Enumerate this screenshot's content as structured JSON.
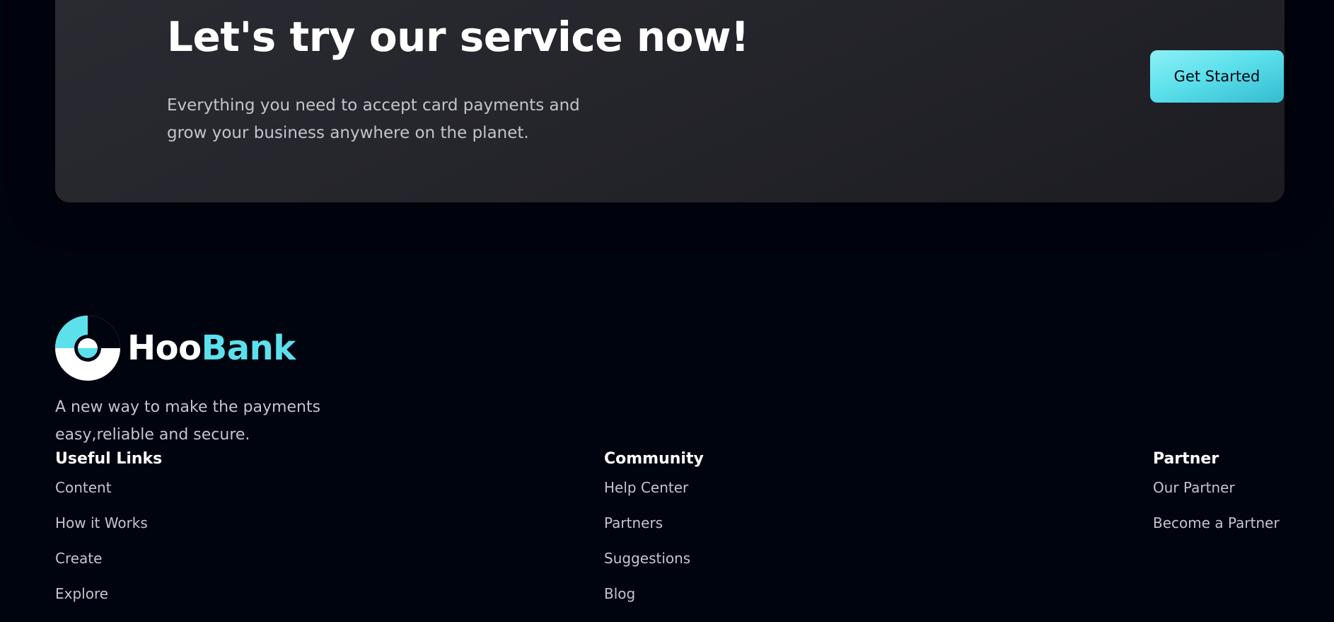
{
  "cta": {
    "title": "Let's try our service now!",
    "description": "Everything you need to accept card payments and grow your business anywhere on the planet.",
    "button_label": "Get Started"
  },
  "brand": {
    "name_part1": "Hoo",
    "name_part2": "Bank",
    "tagline": "A new way to make the payments easy,reliable and secure."
  },
  "footer_columns": [
    {
      "title": "Useful Links",
      "links": [
        "Content",
        "How it Works",
        "Create",
        "Explore"
      ]
    },
    {
      "title": "Community",
      "links": [
        "Help Center",
        "Partners",
        "Suggestions",
        "Blog"
      ]
    },
    {
      "title": "Partner",
      "links": [
        "Our Partner",
        "Become a Partner"
      ]
    }
  ],
  "colors": {
    "background": "#00040f",
    "accent": "#5ce1ec",
    "text_muted": "#c3c5cc",
    "card": "#26262d"
  },
  "icons": {
    "logo": "hoobank-logo-icon"
  }
}
